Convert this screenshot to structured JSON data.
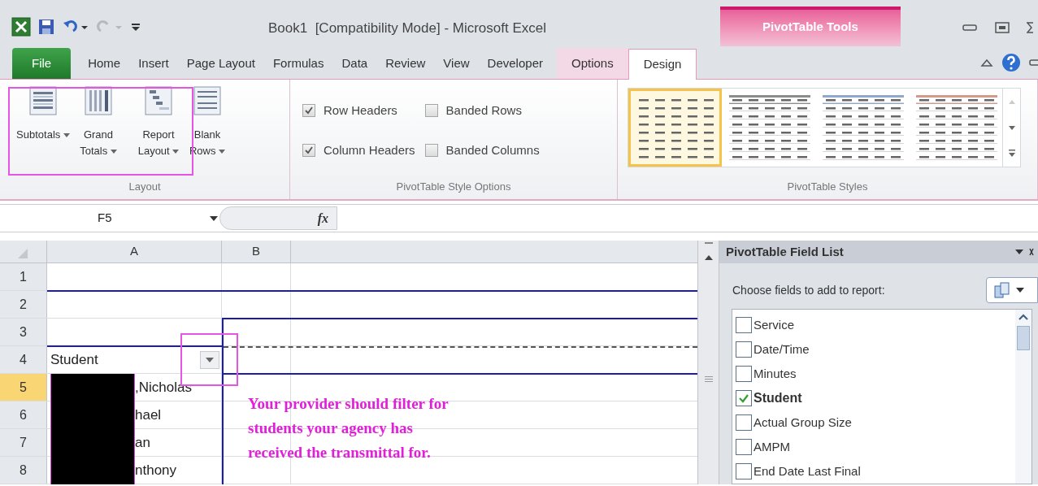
{
  "window": {
    "title": "Book1  [Compatibility Mode] - Microsoft Excel",
    "contextual_group": "PivotTable Tools"
  },
  "ribbon_tabs": [
    {
      "label": "File",
      "kind": "file",
      "selected": false
    },
    {
      "label": "Home",
      "kind": "normal",
      "selected": false
    },
    {
      "label": "Insert",
      "kind": "normal",
      "selected": false
    },
    {
      "label": "Page Layout",
      "kind": "normal",
      "selected": false
    },
    {
      "label": "Formulas",
      "kind": "normal",
      "selected": false
    },
    {
      "label": "Data",
      "kind": "normal",
      "selected": false
    },
    {
      "label": "Review",
      "kind": "normal",
      "selected": false
    },
    {
      "label": "View",
      "kind": "normal",
      "selected": false
    },
    {
      "label": "Developer",
      "kind": "normal",
      "selected": false
    },
    {
      "label": "Options",
      "kind": "contextual",
      "selected": false
    },
    {
      "label": "Design",
      "kind": "contextual",
      "selected": true
    }
  ],
  "layout_group": {
    "label": "Layout",
    "buttons": [
      {
        "label": "Subtotals",
        "kind": "subtotals"
      },
      {
        "label": "Grand Totals",
        "kind": "grand-totals"
      },
      {
        "label": "Report Layout",
        "kind": "report-layout"
      },
      {
        "label": "Blank Rows",
        "kind": "blank-rows"
      }
    ]
  },
  "style_options": {
    "label": "PivotTable Style Options",
    "options": [
      {
        "label": "Row Headers",
        "checked": true
      },
      {
        "label": "Banded Rows",
        "checked": false
      },
      {
        "label": "Column Headers",
        "checked": true
      },
      {
        "label": "Banded Columns",
        "checked": false
      }
    ]
  },
  "styles": {
    "label": "PivotTable Styles",
    "items": [
      {
        "selected": true
      },
      {
        "selected": false,
        "color": "#8c8c8c"
      },
      {
        "selected": false,
        "color": "#8fa9cc"
      },
      {
        "selected": false,
        "color": "#d39a8c"
      }
    ]
  },
  "formula_bar": {
    "name_box": "F5",
    "function_label": "fx"
  },
  "sheet": {
    "columns": [
      "A",
      "B"
    ],
    "rows": [
      {
        "number": "1",
        "selected": false
      },
      {
        "number": "2",
        "selected": false
      },
      {
        "number": "3",
        "selected": false
      },
      {
        "number": "4",
        "selected": false,
        "cell_a": "Student",
        "filter_dropdown": true
      },
      {
        "number": "5",
        "selected": true,
        "cell_a": ",Nicholas",
        "redacted": true
      },
      {
        "number": "6",
        "selected": false,
        "cell_a": "hael",
        "redacted": true
      },
      {
        "number": "7",
        "selected": false,
        "cell_a": "an",
        "redacted": true
      },
      {
        "number": "8",
        "selected": false,
        "cell_a": "nthony",
        "redacted": true
      }
    ]
  },
  "annotation": {
    "text": "Your provider should filter for\nstudents your agency has\nreceived the transmittal for."
  },
  "field_list": {
    "title": "PivotTable Field List",
    "prompt": "Choose fields to add to report:",
    "fields": [
      {
        "label": "Service",
        "checked": false
      },
      {
        "label": "Date/Time",
        "checked": false
      },
      {
        "label": "Minutes",
        "checked": false
      },
      {
        "label": "Student",
        "checked": true
      },
      {
        "label": "Actual Group Size",
        "checked": false
      },
      {
        "label": "AMPM",
        "checked": false
      },
      {
        "label": "End Date Last Final",
        "checked": false
      }
    ]
  }
}
